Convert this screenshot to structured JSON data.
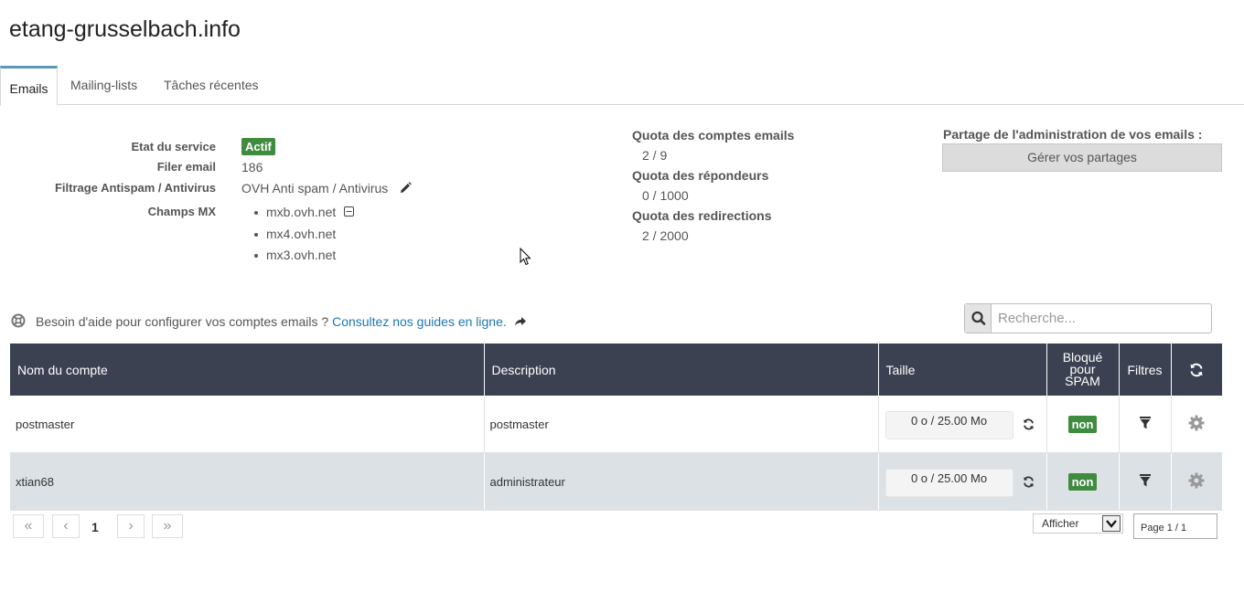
{
  "page": {
    "title": "etang-grusselbach.info"
  },
  "tabs": [
    {
      "label": "Emails",
      "active": true
    },
    {
      "label": "Mailing-lists",
      "active": false
    },
    {
      "label": "Tâches récentes",
      "active": false
    }
  ],
  "service": {
    "status_label": "Etat du service",
    "status_value": "Actif",
    "filer_label": "Filer email",
    "filer_value": "186",
    "antispam_label": "Filtrage Antispam / Antivirus",
    "antispam_value": "OVH Anti spam / Antivirus",
    "mx_label": "Champs MX",
    "mx_records": [
      "mxb.ovh.net",
      "mx4.ovh.net",
      "mx3.ovh.net"
    ]
  },
  "quotas": [
    {
      "label": "Quota des comptes emails",
      "value": "2 / 9"
    },
    {
      "label": "Quota des répondeurs",
      "value": "0 / 1000"
    },
    {
      "label": "Quota des redirections",
      "value": "2 / 2000"
    }
  ],
  "share": {
    "label": "Partage de l'administration de vos emails :",
    "button": "Gérer vos partages"
  },
  "help": {
    "text": "Besoin d'aide pour configurer vos comptes emails ?",
    "link": "Consultez nos guides en ligne."
  },
  "search": {
    "placeholder": "Recherche..."
  },
  "table": {
    "headers": {
      "name": "Nom du compte",
      "description": "Description",
      "size": "Taille",
      "spam_line1": "Bloqué",
      "spam_line2": "pour",
      "spam_line3": "SPAM",
      "filters": "Filtres"
    },
    "rows": [
      {
        "name": "postmaster",
        "description": "postmaster",
        "size": "0 o / 25.00 Mo",
        "spam": "non"
      },
      {
        "name": "xtian68",
        "description": "administrateur",
        "size": "0 o / 25.00 Mo",
        "spam": "non"
      }
    ]
  },
  "pagination": {
    "current_page": "1",
    "afficher": "Afficher",
    "page_info": "Page 1 / 1"
  },
  "colors": {
    "accent": "#5a9ab8",
    "header_bg": "#3b4151",
    "status_green": "#3f8b3f",
    "link": "#1d77b0"
  }
}
